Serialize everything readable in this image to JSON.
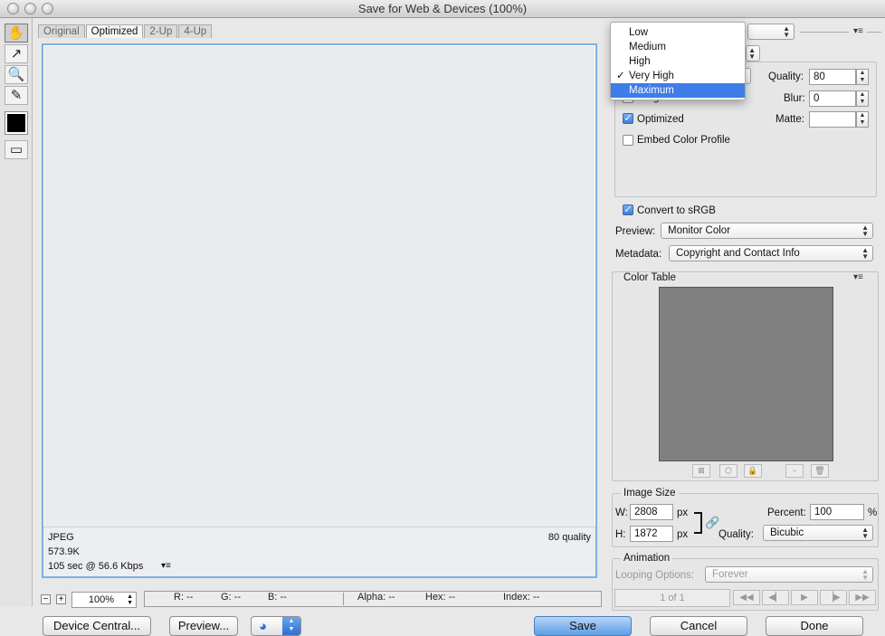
{
  "window": {
    "title": "Save for Web & Devices (100%)"
  },
  "tabs": [
    "Original",
    "Optimized",
    "2-Up",
    "4-Up"
  ],
  "preview": {
    "format": "JPEG",
    "size": "573.9K",
    "speed": "105 sec @ 56.6 Kbps",
    "quality_label": "80 quality"
  },
  "status": {
    "zoom": "100%",
    "r": "R: --",
    "g": "G: --",
    "b": "B: --",
    "alpha": "Alpha: --",
    "hex": "Hex: --",
    "index": "Index: --"
  },
  "buttons": {
    "device_central": "Device Central...",
    "preview": "Preview...",
    "save": "Save",
    "cancel": "Cancel",
    "done": "Done"
  },
  "quality_menu": {
    "items": [
      "Low",
      "Medium",
      "High",
      "Very High",
      "Maximum"
    ],
    "checked": "Very High",
    "highlighted": "Maximum"
  },
  "settings": {
    "quality_label": "Quality:",
    "quality_value": "80",
    "blur_label": "Blur:",
    "blur_value": "0",
    "matte_label": "Matte:",
    "progressive_label": "Progressive",
    "optimized_label": "Optimized",
    "embed_profile_label": "Embed Color Profile",
    "convert_srgb_label": "Convert to sRGB",
    "preview_label": "Preview:",
    "preview_value": "Monitor Color",
    "metadata_label": "Metadata:",
    "metadata_value": "Copyright and Contact Info"
  },
  "color_table": {
    "title": "Color Table",
    "swatch_color": "#808080"
  },
  "image_size": {
    "title": "Image Size",
    "w_label": "W:",
    "w_value": "2808",
    "h_label": "H:",
    "h_value": "1872",
    "unit": "px",
    "percent_label": "Percent:",
    "percent_value": "100",
    "percent_unit": "%",
    "quality_label": "Quality:",
    "quality_value": "Bicubic"
  },
  "animation": {
    "title": "Animation",
    "looping_label": "Looping Options:",
    "looping_value": "Forever",
    "frame": "1 of 1"
  },
  "colors": {
    "accent": "#3e7ce8",
    "preview_border": "#7fb0e0"
  }
}
